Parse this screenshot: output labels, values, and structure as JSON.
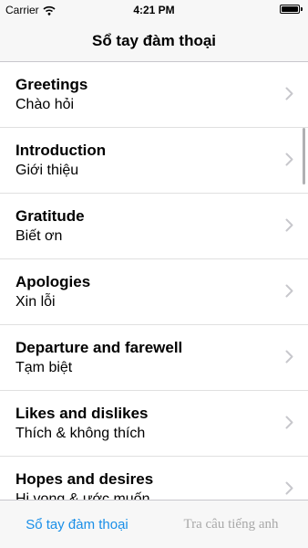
{
  "status_bar": {
    "carrier": "Carrier",
    "time": "4:21 PM",
    "wifi_icon": "wifi-icon",
    "battery_icon": "battery-icon",
    "battery_level": 1.0
  },
  "nav": {
    "title": "Sổ tay đàm thoại"
  },
  "list": {
    "items": [
      {
        "title": "Greetings",
        "subtitle": "Chào hỏi"
      },
      {
        "title": "Introduction",
        "subtitle": "Giới thiệu"
      },
      {
        "title": "Gratitude",
        "subtitle": "Biết ơn"
      },
      {
        "title": "Apologies",
        "subtitle": "Xin lỗi"
      },
      {
        "title": "Departure and farewell",
        "subtitle": "Tạm biệt"
      },
      {
        "title": "Likes and dislikes",
        "subtitle": "Thích & không thích"
      },
      {
        "title": "Hopes and desires",
        "subtitle": "Hi vọng & ước muốn"
      }
    ],
    "chevron_icon": "chevron-right-icon"
  },
  "tabs": [
    {
      "label": "Sổ tay đàm thoại",
      "active": true
    },
    {
      "label": "Tra câu tiếng anh",
      "active": false
    }
  ],
  "colors": {
    "accent": "#1a8fe8",
    "inactive_tab": "#a8a8a8",
    "bar_background": "#f7f7f7",
    "separator": "#e0e0e0"
  }
}
